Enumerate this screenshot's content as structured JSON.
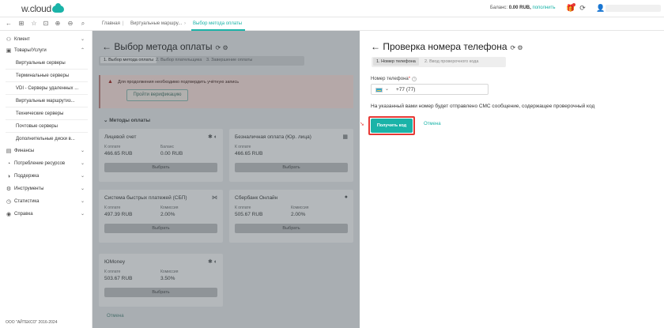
{
  "topbar": {
    "logo": "w.cloud",
    "balance_label": "Баланс:",
    "balance_value": "0.00 RUB,",
    "topup": "пополнить"
  },
  "breadcrumbs": [
    "Главная",
    "Виртуальные маршру...",
    "Выбор метода оплаты"
  ],
  "sidebar": {
    "items": [
      {
        "label": "Клиент",
        "icon": "person-icon",
        "chevron": "⌄"
      },
      {
        "label": "Товары/Услуги",
        "icon": "box-icon",
        "chevron": "⌃"
      },
      {
        "label": "Финансы",
        "icon": "wallet-icon",
        "chevron": "⌄"
      },
      {
        "label": "Потребление ресурсов",
        "icon": "gauge-icon",
        "chevron": "⌄"
      },
      {
        "label": "Поддержка",
        "icon": "headset-icon",
        "chevron": "⌄"
      },
      {
        "label": "Инструменты",
        "icon": "tools-icon",
        "chevron": "⌄"
      },
      {
        "label": "Статистика",
        "icon": "stats-icon",
        "chevron": "⌄"
      },
      {
        "label": "Справка",
        "icon": "help-icon",
        "chevron": "⌄"
      }
    ],
    "subitems": [
      "Виртуальные серверы",
      "Терминальные серверы",
      "VDI - Серверы удаленных ...",
      "Виртуальные маршрутиз...",
      "Технические серверы",
      "Почтовые серверы",
      "Дополнительные диски в..."
    ],
    "footer": "ООО \"АЙТЕКСО\" 2016-2024"
  },
  "main": {
    "title": "Выбор метода оплаты",
    "steps": [
      "1. Выбор метода оплаты",
      "2. Выбор плательщика",
      "3. Завершение оплаты"
    ],
    "alert_text": "Для продолжения необходимо подтвердить учётную запись",
    "verify_button": "Пройти верификацию",
    "methods_heading": "Методы оплаты",
    "cards": [
      {
        "title": "Лицевой счет",
        "l1": "К оплате",
        "v1": "466.65 RUB",
        "l2": "Баланс",
        "v2": "0.00 RUB",
        "button": "Выбрать"
      },
      {
        "title": "Безналичная оплата (Юр. лица)",
        "l1": "К оплате",
        "v1": "466.65 RUB",
        "l2": "",
        "v2": "",
        "button": "Выбрать"
      },
      {
        "title": "Система быстрых платежей (СБП)",
        "l1": "К оплате",
        "v1": "497.39 RUB",
        "l2": "Комиссия",
        "v2": "2.00%",
        "button": "Выбрать"
      },
      {
        "title": "Сбербанк Онлайн",
        "l1": "К оплате",
        "v1": "505.67 RUB",
        "l2": "Комиссия",
        "v2": "2.00%",
        "button": "Выбрать"
      },
      {
        "title": "ЮMoney",
        "l1": "К оплате",
        "v1": "503.67 RUB",
        "l2": "Комиссия",
        "v2": "3.50%",
        "button": "Выбрать"
      }
    ],
    "cancel": "Отмена"
  },
  "panel": {
    "title": "Проверка номера телефона",
    "steps": [
      "1. Номер телефона",
      "2. Ввод проверочного кода"
    ],
    "phone_label": "Номер телефона",
    "phone_required": "*",
    "phone_value": "+77 (77)",
    "sms_note": "На указанный вами номер будет отправлено СМС сообщение, содержащее проверочный код",
    "get_code": "Получить код",
    "cancel": "Отмена"
  }
}
